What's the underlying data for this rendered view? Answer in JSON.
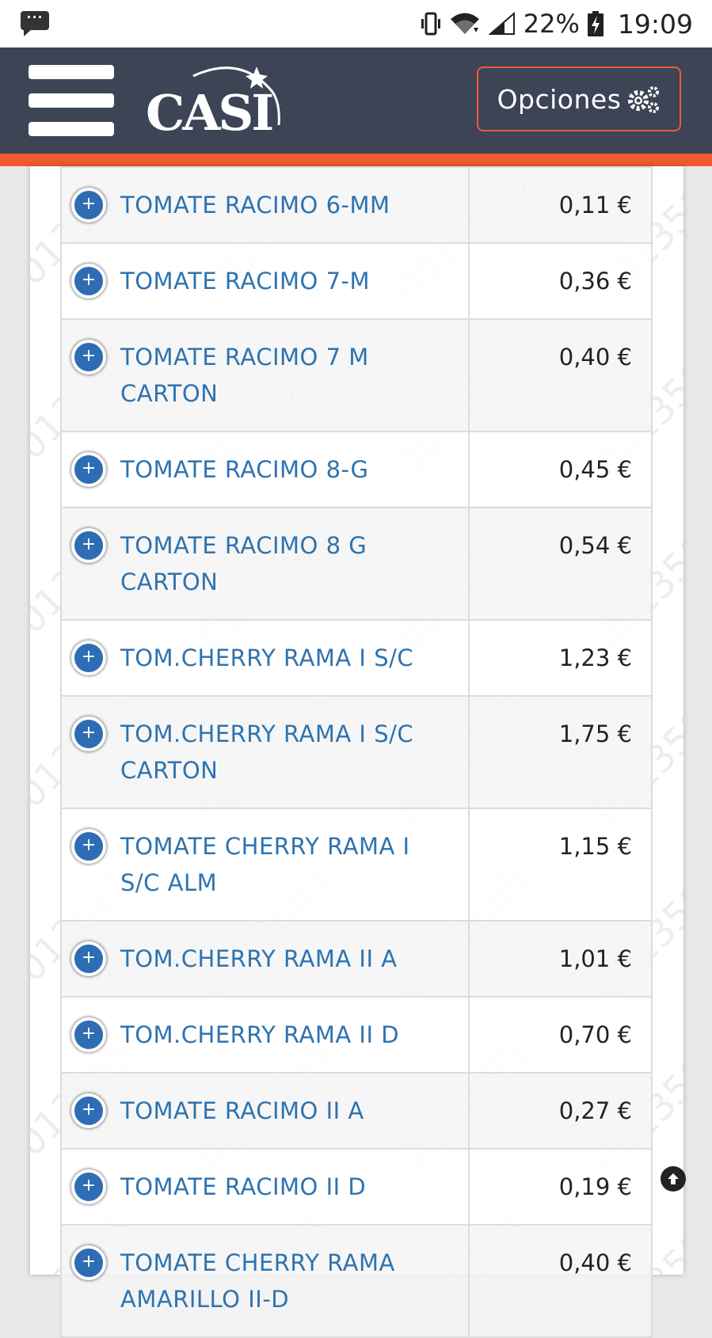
{
  "status_bar": {
    "notification_icon": "chat-bubble-icon",
    "notification_text": "···",
    "battery_percent": "22%",
    "time": "19:09"
  },
  "header": {
    "logo_text": "CASI",
    "options_label": "Opciones",
    "accent_color": "#f05a2e",
    "bg_color": "#3c4455"
  },
  "products": [
    {
      "name": "TOMATE RACIMO 6-MM",
      "price": "0,11 €"
    },
    {
      "name": "TOMATE RACIMO 7-M",
      "price": "0,36 €"
    },
    {
      "name": "TOMATE RACIMO 7 M CARTON",
      "price": "0,40 €"
    },
    {
      "name": "TOMATE RACIMO 8-G",
      "price": "0,45 €"
    },
    {
      "name": "TOMATE RACIMO 8 G CARTON",
      "price": "0,54 €"
    },
    {
      "name": "TOM.CHERRY RAMA I S/C",
      "price": "1,23 €"
    },
    {
      "name": "TOM.CHERRY RAMA I S/C CARTON",
      "price": "1,75 €"
    },
    {
      "name": "TOMATE CHERRY RAMA I S/C ALM",
      "price": "1,15 €"
    },
    {
      "name": "TOM.CHERRY RAMA II A",
      "price": "1,01 €"
    },
    {
      "name": "TOM.CHERRY RAMA II D",
      "price": "0,70 €"
    },
    {
      "name": "TOMATE RACIMO II A",
      "price": "0,27 €"
    },
    {
      "name": "TOMATE RACIMO II D",
      "price": "0,19 €"
    },
    {
      "name": "TOMATE CHERRY RAMA AMARILLO II-D",
      "price": "0,40 €"
    }
  ]
}
